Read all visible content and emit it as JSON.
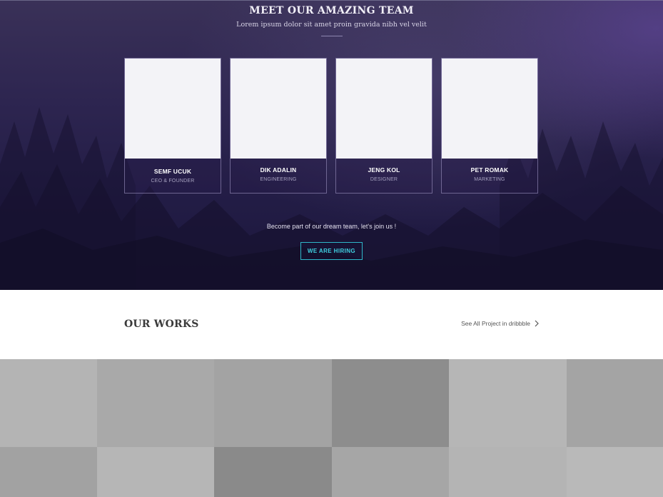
{
  "team": {
    "title": "MEET OUR AMAZING TEAM",
    "subtitle": "Lorem ipsum dolor sit amet proin gravida nibh vel velit",
    "members": [
      {
        "name": "SEMF UCUK",
        "role": "CEO & FOUNDER"
      },
      {
        "name": "DIK ADALIN",
        "role": "ENGINEERING"
      },
      {
        "name": "JENG KOL",
        "role": "DESIGNER"
      },
      {
        "name": "PET ROMAK",
        "role": "MARKETING"
      }
    ],
    "join_text": "Become part of our dream team, let's join us !",
    "hiring_button": "WE ARE HIRING",
    "colors": {
      "accent": "#2fb6c9",
      "overlay": "#2d2550"
    }
  },
  "works": {
    "title": "OUR WORKS",
    "link_text": "See All Project in dribbble",
    "link_icon": "chevron-right-icon",
    "tile_colors": [
      [
        "#b4b4b4",
        "#a9a9a9",
        "#a3a3a3",
        "#8d8d8d",
        "#b6b6b6",
        "#a4a4a4"
      ],
      [
        "#a2a2a2",
        "#b6b6b6",
        "#8a8a8a",
        "#a6a6a6",
        "#b4b4b4",
        "#b9b9b9"
      ]
    ]
  }
}
